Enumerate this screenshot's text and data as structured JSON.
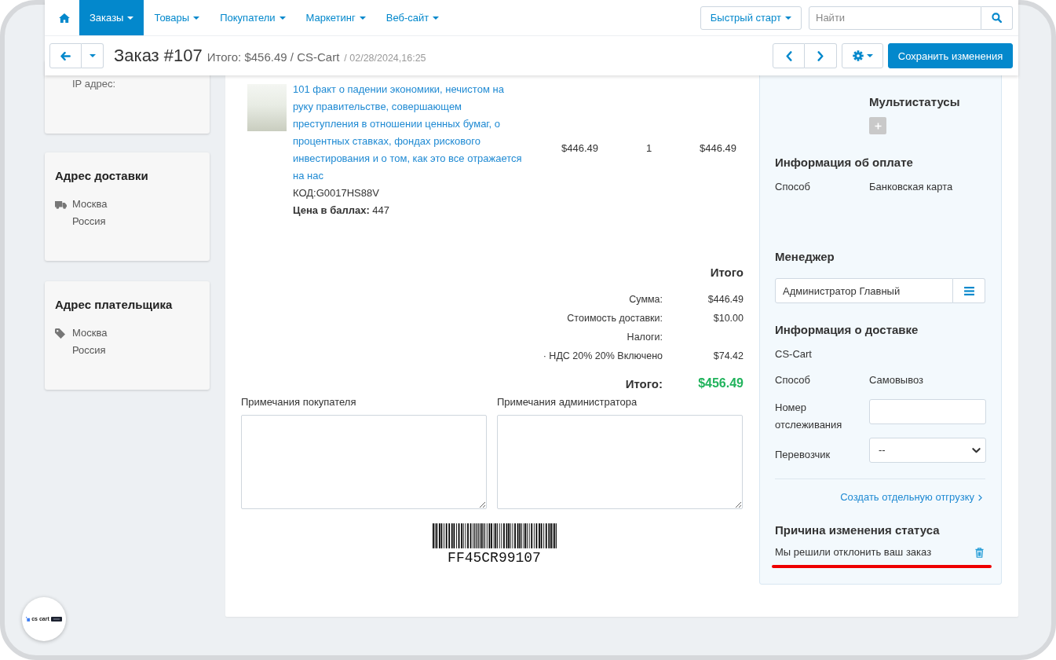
{
  "nav": {
    "tabs": [
      {
        "label": "Заказы",
        "selected": true
      },
      {
        "label": "Товары",
        "selected": false
      },
      {
        "label": "Покупатели",
        "selected": false
      },
      {
        "label": "Маркетинг",
        "selected": false
      },
      {
        "label": "Веб-сайт",
        "selected": false
      }
    ],
    "quick_start": "Быстрый старт",
    "search": {
      "placeholder": "Найти"
    }
  },
  "title_bar": {
    "title": "Заказ #107",
    "summary": "Итого: $456.49 / CS-Cart",
    "date": "/ 02/28/2024,16:25",
    "save_button": "Сохранить изменения"
  },
  "left_cards": [
    {
      "kind": "info",
      "lines": [
        "IP адрес:"
      ]
    },
    {
      "kind": "shipping",
      "title": "Адрес доставки",
      "lines": [
        "Москва",
        "Россия"
      ]
    },
    {
      "kind": "billing",
      "title": "Адрес плательщика",
      "lines": [
        "Москва",
        "Россия"
      ]
    }
  ],
  "products": [
    {
      "name": "101 факт о падении экономики, нечистом на руку правительстве, совершающем преступления в отношении ценных бумаг, о процентных ставках, фондах рискового инвестирования и о том, как это все отражается на нас",
      "code": "КОД:G0017HS88V",
      "points": "**Цена в баллах:** 447",
      "price": "$446.49",
      "quantity": "1",
      "subtotal": "$446.49"
    }
  ],
  "totals": {
    "title": "Итого",
    "rows": [
      {
        "label": "Сумма:",
        "value": "$446.49"
      },
      {
        "label": "Стоимость доставки:",
        "value": "$10.00"
      },
      {
        "label": "Налоги:"
      },
      {
        "label": "· НДС 20% 20% Включено",
        "value": "$74.42"
      }
    ],
    "grand_total": {
      "label": "Итого:",
      "value": "$456.49"
    }
  },
  "notes": [
    {
      "label": "Примечания покупателя"
    },
    {
      "label": "Примечания администратора"
    }
  ],
  "barcode": {
    "code": "FF45CR99107"
  },
  "sidebar": {
    "multistatus": {
      "title": "Мультистатусы"
    },
    "payment": {
      "title": "Информация об оплате",
      "rows": [
        {
          "label": "Способ",
          "value": "Банковская карта"
        }
      ]
    },
    "manager": {
      "title": "Менеджер",
      "value": "Администратор Главный"
    },
    "shipping": {
      "title": "Информация о доставке",
      "company": "CS-Cart",
      "rows": [
        {
          "kind": "text",
          "label": "Способ",
          "value": "Самовывоз"
        },
        {
          "kind": "input",
          "label": "Номер отслеживания"
        },
        {
          "kind": "select",
          "label": "Перевозчик",
          "value": "--"
        }
      ],
      "link": "Создать отдельную отгрузку"
    },
    "status_reason": {
      "title": "Причина изменения статуса",
      "text": "Мы решили отклонить ваш заказ",
      "underlined": true
    }
  },
  "logo": {
    "text": "cs cart"
  }
}
